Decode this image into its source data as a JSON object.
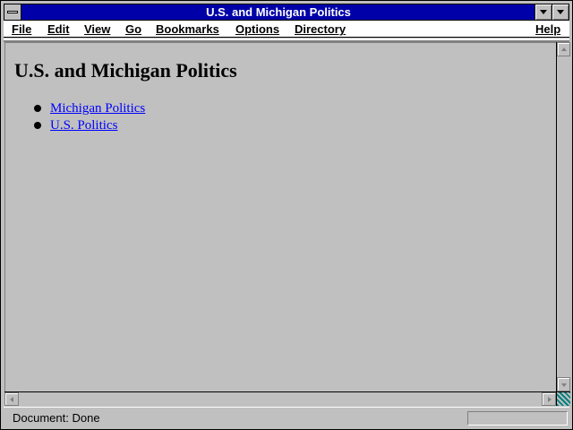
{
  "window": {
    "title": "U.S. and Michigan Politics"
  },
  "menu": {
    "file": "File",
    "edit": "Edit",
    "view": "View",
    "go": "Go",
    "bookmarks": "Bookmarks",
    "options": "Options",
    "directory": "Directory",
    "help": "Help"
  },
  "page": {
    "heading": "U.S. and Michigan Politics",
    "links": [
      {
        "label": "Michigan Politics"
      },
      {
        "label": "U.S. Politics"
      }
    ]
  },
  "status": {
    "text": "Document: Done"
  },
  "colors": {
    "title_bar": "#0000a8",
    "link": "#0000ff",
    "background": "#c0c0c0"
  }
}
